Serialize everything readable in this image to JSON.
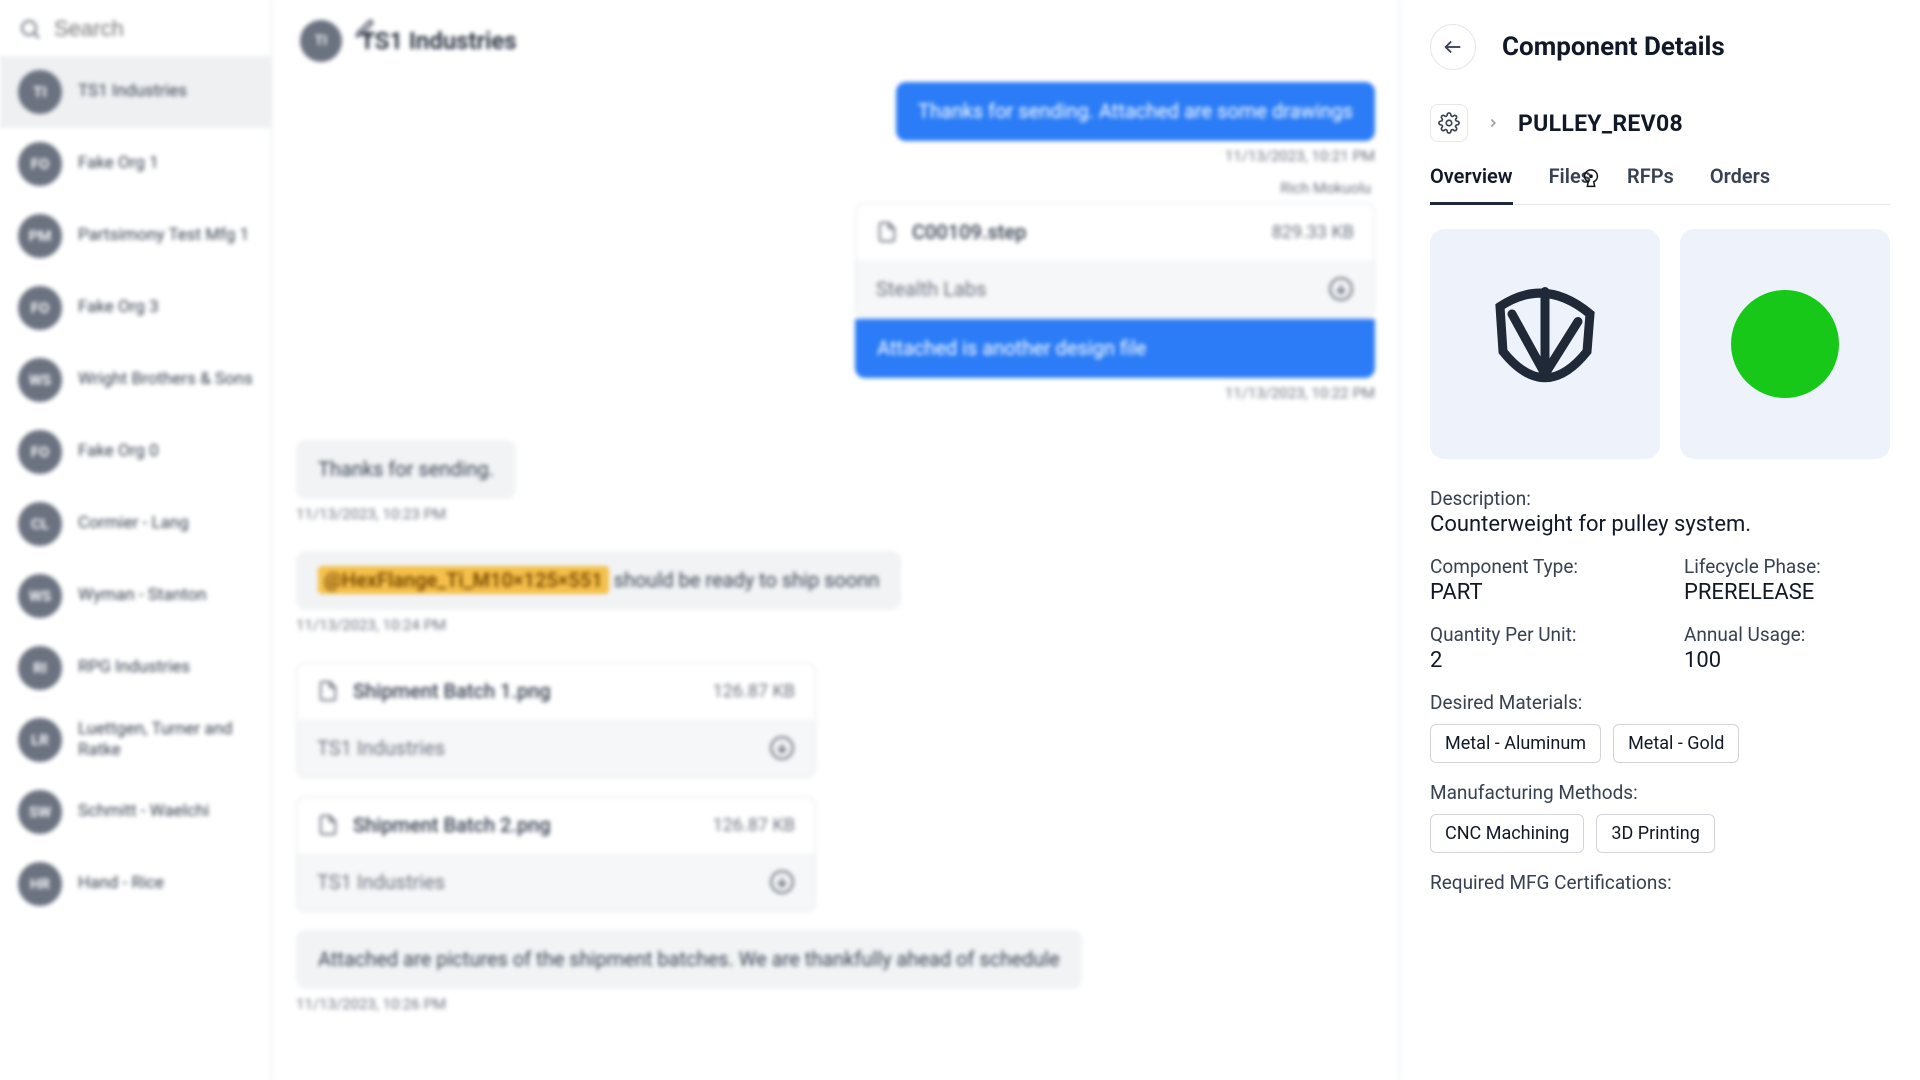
{
  "sidebar": {
    "search_placeholder": "Search",
    "conversations": [
      {
        "initials": "TI",
        "name": "TS1 Industries",
        "active": true
      },
      {
        "initials": "FO",
        "name": "Fake Org 1"
      },
      {
        "initials": "PM",
        "name": "Partsimony Test Mfg 1"
      },
      {
        "initials": "FO",
        "name": "Fake Org 3"
      },
      {
        "initials": "WS",
        "name": "Wright Brothers & Sons"
      },
      {
        "initials": "FO",
        "name": "Fake Org 0"
      },
      {
        "initials": "CL",
        "name": "Cormier - Lang"
      },
      {
        "initials": "WS",
        "name": "Wyman - Stanton"
      },
      {
        "initials": "RI",
        "name": "RPG Industries"
      },
      {
        "initials": "LR",
        "name": "Luettgen, Turner and Ratke"
      },
      {
        "initials": "SW",
        "name": "Schmitt - Waelchi"
      },
      {
        "initials": "HR",
        "name": "Hand - Rice"
      }
    ]
  },
  "chat": {
    "title_initials": "TI",
    "title": "TS1 Industries",
    "msg_blue_1": "Thanks for sending. Attached are some drawings",
    "ts_1": "11/13/2023, 10:21 PM",
    "sender_1": "Rich Mokuolu",
    "att_1_name": "C00109.step",
    "att_1_size": "829.33 KB",
    "att_1_src": "Stealth Labs",
    "msg_blue_2": "Attached is another design file",
    "ts_2": "11/13/2023, 10:22 PM",
    "msg_gray_1": "Thanks for sending.",
    "ts_3": "11/13/2023, 10:23 PM",
    "mention": "@HexFlange_Ti_M10×125×551",
    "msg_gray_2_rest": " should be ready to ship soonn",
    "ts_4": "11/13/2023, 10:24 PM",
    "att_2_name": "Shipment Batch 1.png",
    "att_2_size": "126.87 KB",
    "att_2_src": "TS1 Industries",
    "att_3_name": "Shipment Batch 2.png",
    "att_3_size": "126.87 KB",
    "att_3_src": "TS1 Industries",
    "msg_gray_3": "Attached are pictures of the shipment batches. We are thankfully ahead of schedule",
    "ts_5": "11/13/2023, 10:26 PM"
  },
  "details": {
    "panel_title": "Component Details",
    "component_name": "PULLEY_REV08",
    "tabs": [
      "Overview",
      "Files",
      "RFPs",
      "Orders"
    ],
    "active_tab": 0,
    "description_label": "Description:",
    "description_value": "Counterweight for pulley system.",
    "type_label": "Component Type:",
    "type_value": "PART",
    "phase_label": "Lifecycle Phase:",
    "phase_value": "PRERELEASE",
    "qty_label": "Quantity Per Unit:",
    "qty_value": "2",
    "usage_label": "Annual Usage:",
    "usage_value": "100",
    "materials_label": "Desired Materials:",
    "materials": [
      "Metal - Aluminum",
      "Metal - Gold"
    ],
    "methods_label": "Manufacturing Methods:",
    "methods": [
      "CNC Machining",
      "3D Printing"
    ],
    "certs_label": "Required MFG Certifications:"
  }
}
